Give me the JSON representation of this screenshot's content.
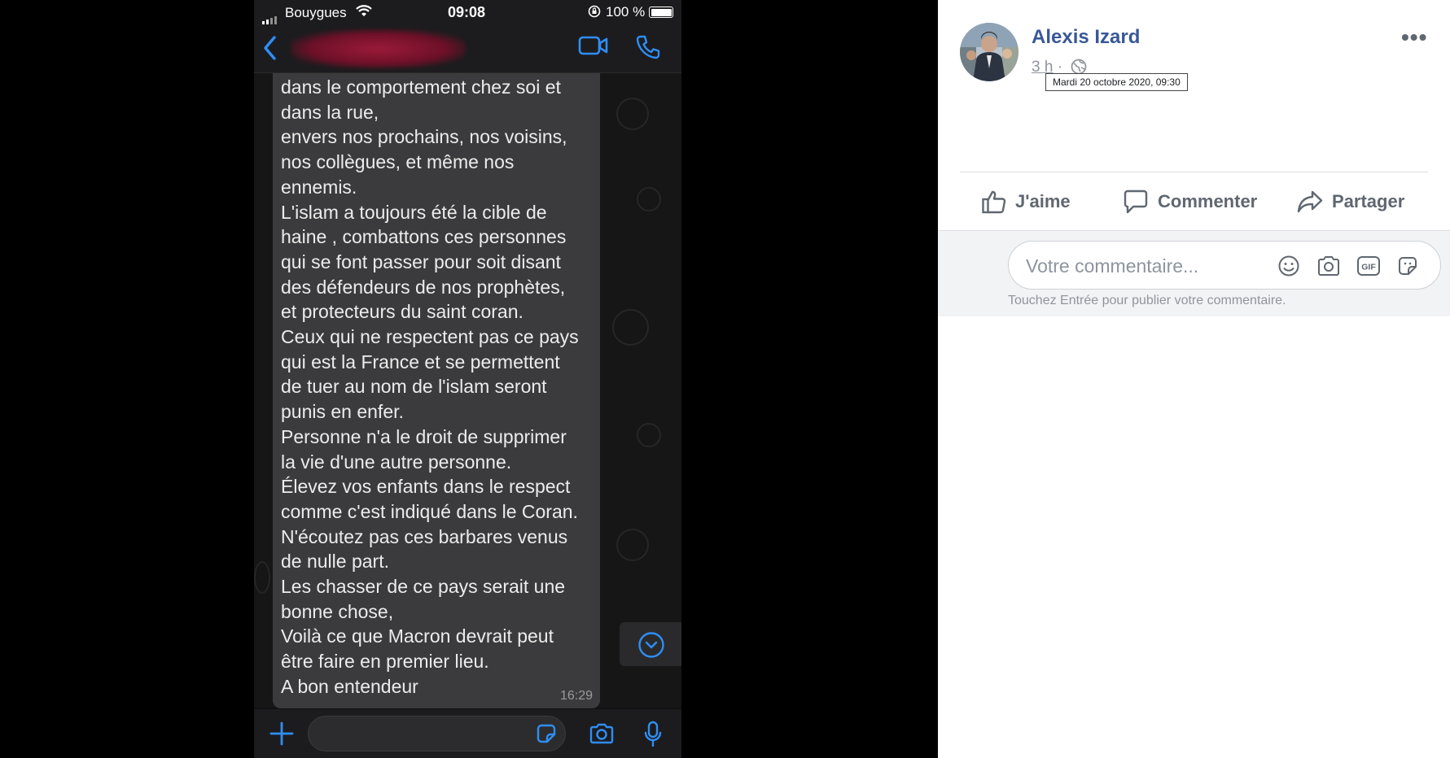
{
  "phone": {
    "status": {
      "carrier": "Bouygues",
      "time": "09:08",
      "battery": "100 %"
    },
    "message": {
      "lines": [
        "dans le comportement chez soi et",
        "dans la rue,",
        "envers nos prochains, nos voisins,",
        "nos collègues, et même nos",
        "ennemis.",
        "L'islam a toujours été la cible de",
        "haine , combattons ces personnes",
        "qui se font passer pour soit disant",
        "des défendeurs de nos prophètes,",
        "et protecteurs du saint coran.",
        "Ceux qui ne respectent pas ce pays",
        "qui est la France et se permettent",
        "de tuer au nom de l'islam seront",
        "punis en enfer.",
        "Personne n'a le droit de supprimer",
        "la vie d'une autre personne.",
        "Élevez vos enfants dans le respect",
        "comme c'est indiqué dans le Coran.",
        "N'écoutez pas ces barbares venus",
        "de nulle part.",
        "Les chasser de ce pays serait une",
        "bonne chose,",
        "Voilà ce que Macron devrait peut",
        "être faire en premier lieu.",
        "A bon entendeur"
      ],
      "timestamp": "16:29"
    }
  },
  "post": {
    "author": "Alexis Izard",
    "time_ago": "3 h",
    "separator": "·",
    "tooltip": "Mardi 20 octobre 2020, 09:30",
    "more": "•••",
    "actions": {
      "like": "J'aime",
      "comment": "Commenter",
      "share": "Partager"
    },
    "comment_placeholder": "Votre commentaire...",
    "comment_hint": "Touchez Entrée pour publier votre commentaire.",
    "gif_label": "GIF"
  },
  "colors": {
    "fb_blue": "#385898",
    "ios_blue": "#2f8ef4",
    "bubble": "#3b3b3d"
  }
}
